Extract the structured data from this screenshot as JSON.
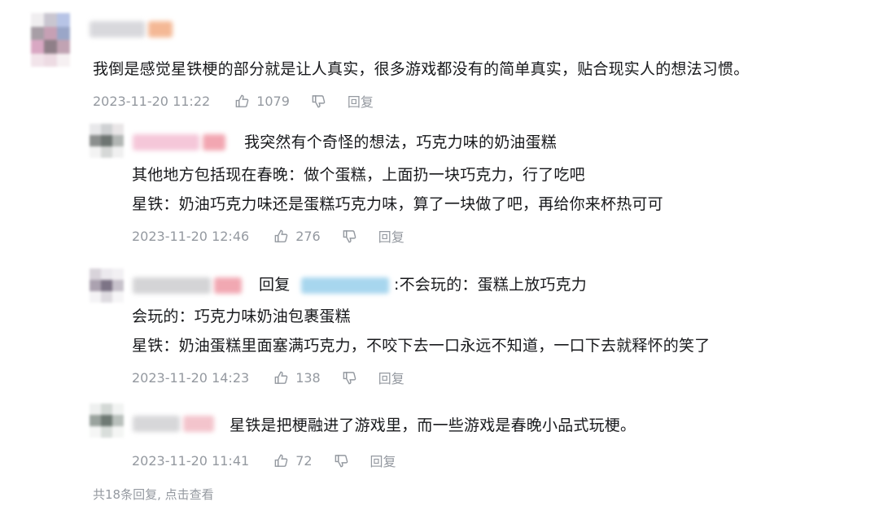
{
  "main_comment": {
    "text": "我倒是感觉星铁梗的部分就是让人真实，很多游戏都没有的简单真实，贴合现实人的想法习惯。",
    "time": "2023-11-20 11:22",
    "likes": "1079",
    "reply_label": "回复"
  },
  "replies": [
    {
      "line1": "我突然有个奇怪的想法，巧克力味的奶油蛋糕",
      "line2": "其他地方包括现在春晚：做个蛋糕，上面扔一块巧克力，行了吃吧",
      "line3": "星铁：奶油巧克力味还是蛋糕巧克力味，算了一块做了吧，再给你来杯热可可",
      "time": "2023-11-20 12:46",
      "likes": "276",
      "reply_label": "回复"
    },
    {
      "reply_prefix": "回复",
      "line1_suffix": ":不会玩的：蛋糕上放巧克力",
      "line2": "会玩的：巧克力味奶油包裹蛋糕",
      "line3": "星铁：奶油蛋糕里面塞满巧克力，不咬下去一口永远不知道，一口下去就释怀的笑了",
      "time": "2023-11-20 14:23",
      "likes": "138",
      "reply_label": "回复"
    },
    {
      "line1": "星铁是把梗融进了游戏里，而一些游戏是春晚小品式玩梗。",
      "time": "2023-11-20 11:41",
      "likes": "72",
      "reply_label": "回复"
    }
  ],
  "footer": {
    "more_replies": "共18条回复, 点击查看"
  },
  "colors": {
    "text": "#18191c",
    "meta": "#9499a0"
  }
}
